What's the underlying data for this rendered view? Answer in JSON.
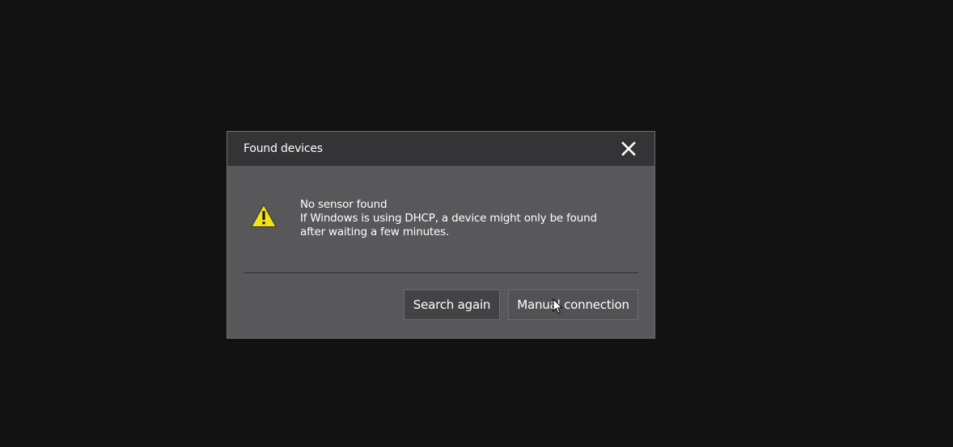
{
  "dialog": {
    "title": "Found devices",
    "close_icon": "close-icon",
    "warning_icon": "warning-triangle-icon",
    "message_title": "No sensor found",
    "message_line1": "If Windows is using DHCP, a device might only be found",
    "message_line2": "after waiting a few minutes.",
    "buttons": {
      "search_again": "Search again",
      "manual_connection": "Manual connection"
    }
  },
  "colors": {
    "background": "#121212",
    "dialog_body": "#58575a",
    "titlebar": "#343336",
    "warning": "#f2e21c"
  }
}
